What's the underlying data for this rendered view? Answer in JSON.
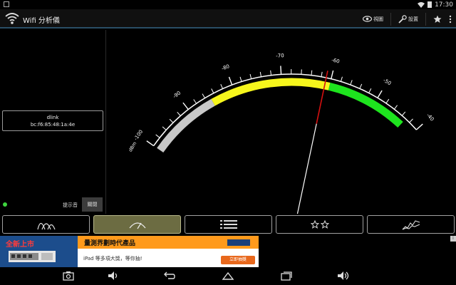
{
  "status_bar": {
    "time": "17:30"
  },
  "app": {
    "title": "Wifi 分析儀",
    "actions": [
      {
        "label": "視圖",
        "icon": "eye-icon"
      },
      {
        "label": "設置",
        "icon": "wrench-icon"
      },
      {
        "label": "",
        "icon": "star-icon"
      },
      {
        "label": "",
        "icon": "overflow-menu-icon"
      }
    ]
  },
  "network": {
    "ssid": "dlink",
    "bssid": "bc:f6:85:48:1a:4e"
  },
  "beep": {
    "label": "提示音",
    "toggle": "關閉",
    "indicator_color": "#3ed43e"
  },
  "gauge": {
    "unit": "dBm",
    "min": -100,
    "max": -40,
    "tick_labels": [
      "-100",
      "-90",
      "-80",
      "-70",
      "-60",
      "-50",
      "-40"
    ],
    "reading": -61,
    "bands": [
      {
        "from": -100,
        "to": -85,
        "color": "#c8c8c8"
      },
      {
        "from": -85,
        "to": -60,
        "color": "#f6f61c"
      },
      {
        "from": -60,
        "to": -43,
        "color": "#1ee41e"
      }
    ],
    "needle_color": "#d41010"
  },
  "tabs": [
    {
      "name": "channel-graph",
      "icon": "channel-graph-icon",
      "active": false
    },
    {
      "name": "signal-meter",
      "icon": "meter-icon",
      "active": true
    },
    {
      "name": "ap-list",
      "icon": "list-icon",
      "active": false
    },
    {
      "name": "channel-rating",
      "icon": "stars-icon",
      "active": false
    },
    {
      "name": "time-graph",
      "icon": "time-graph-icon",
      "active": false
    }
  ],
  "ad": {
    "badge": "全新上市",
    "title": "量測界劃時代產品",
    "text": "iPad 等多項大獎，等你抽!",
    "button": "立即抽獎",
    "info": "i"
  }
}
